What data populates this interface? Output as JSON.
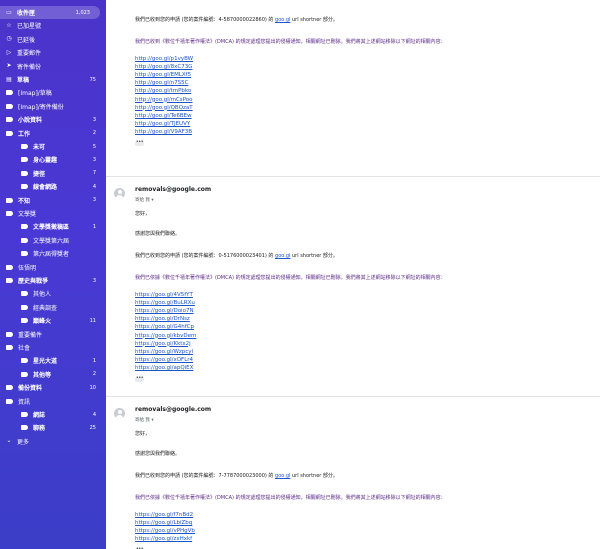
{
  "sidebar": {
    "items": [
      {
        "label": "收件匣",
        "count": "1,023",
        "icon": "inbox-icon",
        "kind": "glyph",
        "glyph": "▭",
        "selected": true,
        "bold": true
      },
      {
        "label": "已加星號",
        "count": "",
        "icon": "star-icon",
        "kind": "glyph",
        "glyph": "☆"
      },
      {
        "label": "已延後",
        "count": "",
        "icon": "clock-icon",
        "kind": "glyph",
        "glyph": "◷"
      },
      {
        "label": "重要郵件",
        "count": "",
        "icon": "label-important-icon",
        "kind": "glyph",
        "glyph": "▷"
      },
      {
        "label": "寄件備份",
        "count": "",
        "icon": "send-icon",
        "kind": "glyph",
        "glyph": "➤"
      },
      {
        "label": "草稿",
        "count": "75",
        "icon": "draft-icon",
        "kind": "glyph",
        "glyph": "▤",
        "bold": true
      },
      {
        "label": "[Imap]/草稿",
        "count": "",
        "icon": "tag-icon",
        "kind": "tag",
        "color": "#ffffff"
      },
      {
        "label": "[Imap]/寄件備份",
        "count": "",
        "icon": "tag-icon",
        "kind": "tag",
        "color": "#ffffff"
      },
      {
        "label": "小說資料",
        "count": "3",
        "icon": "tag-icon",
        "kind": "tag",
        "color": "#ffffff",
        "bold": true
      },
      {
        "label": "工作",
        "count": "2",
        "icon": "tag-icon",
        "kind": "tag",
        "color": "#ffffff",
        "bold": true
      },
      {
        "label": "未可",
        "count": "5",
        "icon": "tag-icon",
        "kind": "tag",
        "color": "#ffffff",
        "bold": true,
        "indent": 1
      },
      {
        "label": "身心靈趣",
        "count": "3",
        "icon": "tag-icon",
        "kind": "tag",
        "color": "#ffffff",
        "bold": true,
        "indent": 1
      },
      {
        "label": "捷徑",
        "count": "7",
        "icon": "tag-icon",
        "kind": "tag",
        "color": "#ffffff",
        "bold": true,
        "indent": 1
      },
      {
        "label": "線會網路",
        "count": "4",
        "icon": "tag-icon",
        "kind": "tag",
        "color": "#ffffff",
        "bold": true,
        "indent": 1
      },
      {
        "label": "不知",
        "count": "3",
        "icon": "tag-icon",
        "kind": "tag",
        "color": "#ffffff",
        "bold": true
      },
      {
        "label": "文學獎",
        "count": "",
        "icon": "tag-icon",
        "kind": "tag",
        "color": "#ffffff"
      },
      {
        "label": "文學獎徵稿區",
        "count": "1",
        "icon": "tag-icon",
        "kind": "tag",
        "color": "#ffffff",
        "bold": true,
        "indent": 1
      },
      {
        "label": "文學獎第六屆",
        "count": "",
        "icon": "tag-icon",
        "kind": "tag",
        "color": "#ffffff",
        "indent": 1
      },
      {
        "label": "第六屆得獎者",
        "count": "",
        "icon": "tag-icon",
        "kind": "tag",
        "color": "#ffffff",
        "indent": 1
      },
      {
        "label": "伍悟明",
        "count": "",
        "icon": "tag-icon",
        "kind": "tag",
        "color": "#ffffff"
      },
      {
        "label": "歷史與戰爭",
        "count": "3",
        "icon": "tag-icon",
        "kind": "tag",
        "color": "#ffffff",
        "bold": true
      },
      {
        "label": "其他人",
        "count": "",
        "icon": "tag-icon",
        "kind": "tag",
        "color": "#ffffff",
        "indent": 1
      },
      {
        "label": "經典調查",
        "count": "",
        "icon": "tag-icon",
        "kind": "tag",
        "color": "#ffffff",
        "indent": 1
      },
      {
        "label": "巔峰火",
        "count": "11",
        "icon": "tag-icon",
        "kind": "tag",
        "color": "#ffffff",
        "bold": true,
        "indent": 1
      },
      {
        "label": "重要備件",
        "count": "",
        "icon": "tag-icon",
        "kind": "tag",
        "color": "#ffffff"
      },
      {
        "label": "社會",
        "count": "",
        "icon": "tag-icon",
        "kind": "tag",
        "color": "#ffffff"
      },
      {
        "label": "星光大道",
        "count": "1",
        "icon": "tag-icon",
        "kind": "tag",
        "color": "#ffffff",
        "bold": true,
        "indent": 1
      },
      {
        "label": "其他等",
        "count": "2",
        "icon": "tag-icon",
        "kind": "tag",
        "color": "#ffffff",
        "bold": true,
        "indent": 1
      },
      {
        "label": "備份資料",
        "count": "10",
        "icon": "tag-icon",
        "kind": "tag",
        "color": "#ffffff",
        "bold": true
      },
      {
        "label": "資訊",
        "count": "",
        "icon": "tag-icon",
        "kind": "tag",
        "color": "#ffffff"
      },
      {
        "label": "網誌",
        "count": "4",
        "icon": "tag-icon",
        "kind": "tag",
        "color": "#ffffff",
        "bold": true,
        "indent": 1
      },
      {
        "label": "聊務",
        "count": "25",
        "icon": "tag-icon",
        "kind": "tag",
        "color": "#ffffff",
        "bold": true,
        "indent": 1
      },
      {
        "label": "更多",
        "count": "",
        "icon": "chevron-down-icon",
        "kind": "glyph",
        "glyph": "⌄"
      }
    ]
  },
  "emails": [
    {
      "sender": "",
      "to_line": "",
      "greeting": "",
      "thanks": "感謝您與我們聯絡。",
      "received_line": "我們已收到您的申請 (您的案件編號：4-5870000022860) 的",
      "link_text": "goo.gl",
      "received_suffix": "url shortner 部分。",
      "dmca_line": "我們已收到《數位千禧年著作權法》(DMCA) 的規定處理您提出的侵權通知，相關網址已刪除。我們將其上述網站移除以下網址的相關內容：",
      "urls": [
        "http://goo.gl/p1vyBW",
        "http://goo.gl/8xC73G",
        "http://goo.gl/EMLXf5",
        "http://goo.gl/n7S5C",
        "http://goo.gl/tmPbko",
        "http://goo.gl/mCsPoo",
        "http://goo.gl/QBQzaT",
        "http://goo.gl/Te6BEw",
        "http://goo.gl/TJEUVY",
        "http://goo.gl/V9AF3B"
      ]
    },
    {
      "sender": "removals@google.com",
      "to_line": "寄給 我 ▾",
      "greeting": "您好，",
      "thanks": "感謝您與我們聯絡。",
      "received_line": "我們已收到您的申請 (您的案件編號：0-5176000023401) 的",
      "link_text": "goo.gl",
      "received_suffix": "url shortner 部分。",
      "dmca_line": "我們已依據《數位千禧年著作權法》(DMCA) 的規定處理您提出的侵權通知，相關網址已刪除。我們將其上述網站移除以下網址的相關內容：",
      "urls": [
        "https://goo.gl/4V5fYT",
        "https://goo.gl/BuLRXu",
        "https://goo.gl/Doio7N",
        "https://goo.gl/DrNsz",
        "https://goo.gl/G4hfCp",
        "https://goo.gl/kbvDem",
        "https://goo.gl/Kktx2j",
        "https://goo.gl/Wzpcyl",
        "https://goo.gl/xOFLr4",
        "https://goo.gl/apQiEX"
      ]
    },
    {
      "sender": "removals@google.com",
      "to_line": "寄給 我 ▾",
      "greeting": "您好，",
      "thanks": "感謝您與我們聯絡。",
      "received_line": "我們已收到您的申請 (您的案件編號：7-7787000023000) 的",
      "link_text": "goo.gl",
      "received_suffix": "url shortner 部分。",
      "dmca_line": "我們已依據《數位千禧年著作權法》(DMCA) 的規定處理您提出的侵權通知，相關網址已刪除。我們將其上述網站移除以下網址的相關內容：",
      "urls": [
        "https://goo.gl/f7nBd2",
        "https://goo.gl/LbiZbq",
        "https://goo.gl/vPHgVb",
        "https://goo.gl/zxHxkf"
      ]
    }
  ],
  "ellipsis": "•••"
}
